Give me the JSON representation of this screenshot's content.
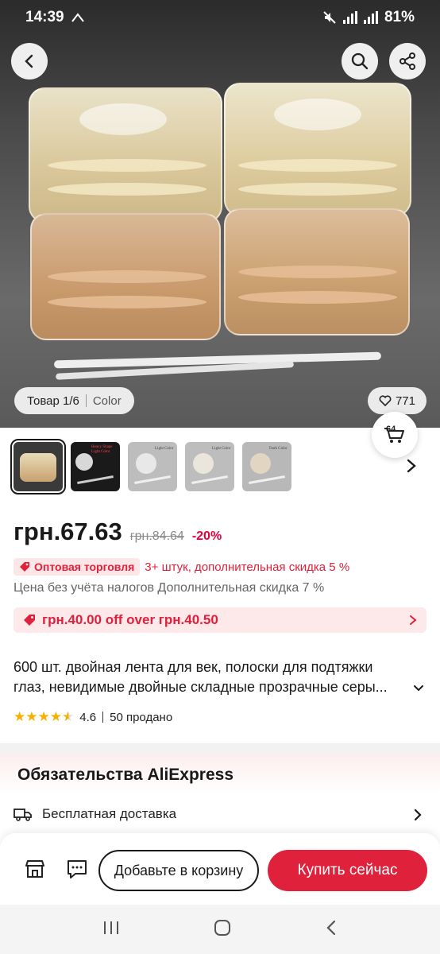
{
  "status_bar": {
    "time": "14:39",
    "battery": "81%"
  },
  "hero": {
    "image_counter": "Товар 1/6",
    "image_filter": "Color",
    "likes": "771",
    "fav_count": "64"
  },
  "thumbnails": [
    {
      "label": ""
    },
    {
      "label": "Heavy Shape Light Color"
    },
    {
      "label": "Light Color"
    },
    {
      "label": "Light Color"
    },
    {
      "label": "Dark Color"
    }
  ],
  "price": {
    "current": "грн.67.63",
    "original": "грн.84.64",
    "discount": "-20%"
  },
  "wholesale": {
    "badge": "Оптовая торговля",
    "text": "3+ штук, дополнительная скидка 5 %"
  },
  "tax_note": "Цена без учёта налогов Дополнительная скидка 7 %",
  "coupon": {
    "text": "грн.40.00 off over грн.40.50"
  },
  "product": {
    "title_line1": "600 шт. двойная лента для век, полоски для подтяжки",
    "title_line2": "глаз, невидимые двойные складные прозрачные серы..."
  },
  "rating": {
    "score": "4.6",
    "sold": "50 продано"
  },
  "commitments": {
    "title": "Обязательства AliExpress",
    "delivery": "Бесплатная доставка"
  },
  "actions": {
    "add_to_cart": "Добавьте в корзину",
    "buy_now": "Купить сейчас"
  },
  "colors": {
    "accent": "#e0213b",
    "coupon_bg": "#fde8ea",
    "star": "#f5b100"
  }
}
